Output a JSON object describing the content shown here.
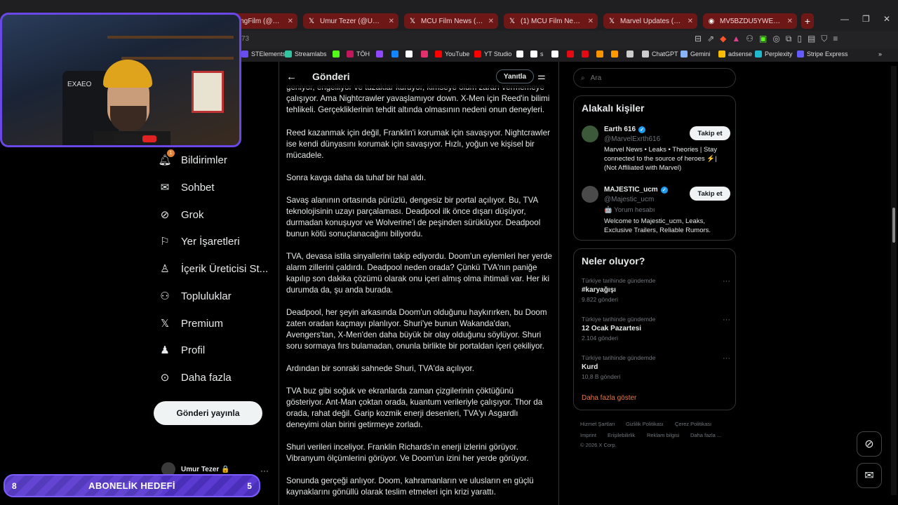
{
  "browser": {
    "tabs": [
      {
        "label": "ssingFilm (@Discussi",
        "icon": "x-icon"
      },
      {
        "label": "Umur Tezer (@Umurtezer) / X",
        "icon": "x-icon"
      },
      {
        "label": "MCU Film News (@MCUFilmN",
        "icon": "x-icon"
      },
      {
        "label": "(1) MCU Film News (@MCUFil",
        "icon": "x-icon"
      },
      {
        "label": "Marvel Updates (@marvel_upd",
        "icon": "x-icon"
      },
      {
        "label": "MV5BZDU5YWE3MmItMGI0N",
        "icon": "globe-icon"
      }
    ],
    "new_tab": "+",
    "url_fragment": "73",
    "bookmarks": [
      {
        "label": "STElements",
        "color": "#6a4df0"
      },
      {
        "label": "Streamlabs",
        "color": "#31c3a2"
      },
      {
        "label": "",
        "color": "#53fc18"
      },
      {
        "label": "TÖH",
        "color": "#c2185b"
      },
      {
        "label": "",
        "color": "#9146ff"
      },
      {
        "label": "",
        "color": "#1185fe"
      },
      {
        "label": "",
        "color": "#ffffff"
      },
      {
        "label": "",
        "color": "#e1306c"
      },
      {
        "label": "YouTube",
        "color": "#ff0000"
      },
      {
        "label": "YT Studio",
        "color": "#ff0000"
      },
      {
        "label": "",
        "color": "#ffffff"
      },
      {
        "label": "s",
        "color": "#ffffff"
      },
      {
        "label": "",
        "color": "#ffffff"
      },
      {
        "label": "",
        "color": "#e50914"
      },
      {
        "label": "",
        "color": "#e50914"
      },
      {
        "label": "",
        "color": "#f79400"
      },
      {
        "label": "",
        "color": "#ff9900"
      },
      {
        "label": "",
        "color": "#cccccc"
      },
      {
        "label": "ChatGPT",
        "color": "#cccccc"
      },
      {
        "label": "Gemini",
        "color": "#8ab4f8"
      },
      {
        "label": "adsense",
        "color": "#fbbc04"
      },
      {
        "label": "Perplexity",
        "color": "#20b8cd"
      },
      {
        "label": "Stripe Express",
        "color": "#635bff"
      }
    ]
  },
  "sidebar": {
    "items": [
      {
        "label": "Bildirimler",
        "icon": "bell-icon",
        "badge": "1"
      },
      {
        "label": "Sohbet",
        "icon": "mail-icon"
      },
      {
        "label": "Grok",
        "icon": "grok-icon"
      },
      {
        "label": "Yer İşaretleri",
        "icon": "bookmark-icon"
      },
      {
        "label": "İçerik Üreticisi St...",
        "icon": "creator-icon"
      },
      {
        "label": "Topluluklar",
        "icon": "communities-icon"
      },
      {
        "label": "Premium",
        "icon": "x-logo-icon"
      },
      {
        "label": "Profil",
        "icon": "profile-icon"
      },
      {
        "label": "Daha fazla",
        "icon": "more-circle-icon"
      }
    ],
    "post_button": "Gönderi yayınla",
    "user_name": "Umur Tezer 🔒",
    "more": "···"
  },
  "post": {
    "header_title": "Gönderi",
    "reply_button": "Yanıtla",
    "paragraphs": [
      "geniyor, engelliyor ve tuzaklar kuruyor, kimseye ölüm zararı vermemeye çalışıyor. Ama Nightcrawler yavaşlamıyor down. X-Men için Reed'in bilimi tehlikeli. Gerçekliklerinin tehdit altında olmasının nedeni onun deneyleri.",
      "Reed kazanmak için değil, Franklin'i korumak için savaşıyor. Nightcrawler ise kendi dünyasını korumak için savaşıyor. Hızlı, yoğun ve kişisel bir mücadele.",
      "Sonra kavga daha da tuhaf bir hal aldı.",
      "Savaş alanının ortasında pürüzlü, dengesiz bir portal açılıyor. Bu, TVA teknolojisinin uzayı parçalaması. Deadpool ilk önce dışarı düşüyor, durmadan konuşuyor ve Wolverine'i de peşinden sürüklüyor. Deadpool bunun kötü sonuçlanacağını biliyordu.",
      "TVA, devasa istila sinyallerini takip ediyordu. Doom'un eylemleri her yerde alarm zillerini çaldırdı. Deadpool neden orada? Çünkü TVA'nın paniğe kapılıp son dakika çözümü olarak onu içeri almış olma ihtimali var. Her iki durumda da, şu anda burada.",
      "Deadpool, her şeyin arkasında Doom'un olduğunu haykırırken, bu Doom zaten oradan kaçmayı planlıyor. Shuri'ye bunun Wakanda'dan, Avengers'tan, X-Men'den daha büyük bir olay olduğunu söylüyor. Shuri soru sormaya fırs bulamadan, onunla birlikte bir portaldan içeri çekiliyor.",
      "Ardından bir sonraki sahnede Shuri, TVA'da açılıyor.",
      "TVA buz gibi soğuk ve ekranlarda zaman çizgilerinin çöktüğünü gösteriyor. Ant-Man çoktan orada, kuantum verileriyle çalışıyor. Thor da orada, rahat değil. Garip kozmik enerji desenleri, TVA'yı Asgardlı deneyimi olan birini getirmeye zorladı.",
      "Shuri verileri inceliyor. Franklin Richards'ın enerji izlerini görüyor. Vibranyum ölçümlerini görüyor. Ve Doom'un izini her yerde görüyor.",
      "Sonunda gerçeği anlıyor. Doom, kahramanların ve ulusların en güçlü kaynaklarını gönüllü olarak teslim etmeleri için krizi yarattı."
    ]
  },
  "right": {
    "search_placeholder": "Ara",
    "related_title": "Alakalı kişiler",
    "people": [
      {
        "name": "Earth 616",
        "handle": "@MarvelExrth616",
        "bio": "Marvel News • Leaks • Theories | Stay connected to the source of heroes ⚡| (Not Affiliated with Marvel)",
        "follow": "Takip et",
        "avatar_color": "#3c5a3a"
      },
      {
        "name": "MAJESTIC_ucm",
        "handle": "@Majestic_ucm",
        "note": "🤖 Yorum hesabı",
        "bio": "Welcome to Majestic_ucm, Leaks, Exclusive Trailers, Reliable Rumors.",
        "follow": "Takip et",
        "avatar_color": "#4a4a4a"
      }
    ],
    "trends_title": "Neler oluyor?",
    "trends": [
      {
        "context": "Türkiye tarihinde gündemde",
        "name": "#karyağışı",
        "count": "9.822 gönderi"
      },
      {
        "context": "Türkiye tarihinde gündemde",
        "name": "12 Ocak Pazartesi",
        "count": "2.104 gönderi"
      },
      {
        "context": "Türkiye tarihinde gündemde",
        "name": "Kurd",
        "count": "10,8 B gönderi"
      }
    ],
    "trend_more": "···",
    "show_more": "Daha fazla göster",
    "footer": {
      "terms": "Hizmet Şartları",
      "privacy": "Gizlilik Politikası",
      "cookies": "Çerez Politikası",
      "imprint": "Imprint",
      "accessibility": "Erişilebilirlik",
      "ads": "Reklam bilgisi",
      "more": "Daha fazla ...",
      "copyright": "© 2026 X Corp."
    }
  },
  "overlay": {
    "goal_left": "8",
    "goal_title": "ABONELİK HEDEFİ",
    "goal_right": "5",
    "goal_progress": 0.625,
    "chair_logo": "EXAEO"
  }
}
